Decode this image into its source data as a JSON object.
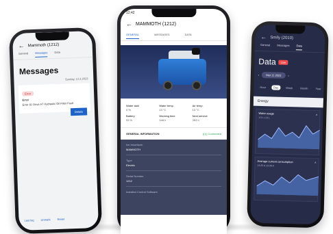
{
  "left_phone": {
    "header_title": "Mammoth (1212)",
    "tabs": [
      "General",
      "Messages",
      "Data"
    ],
    "active_tab": 1,
    "title": "Messages",
    "card": {
      "date": "Sunday, 12.3.2023",
      "tag": "Error",
      "line1": "Error",
      "text": "Error 81 Drive A7 Hydraulic Oil Filter Fault",
      "button": "Details"
    },
    "footer_links": [
      "Last log",
      "Unmark",
      "Reset"
    ]
  },
  "center_phone": {
    "status_time": "12:42",
    "header_title": "MAMMOTH (1212)",
    "tabs": [
      "GENERAL",
      "MESSAGES",
      "DATA"
    ],
    "active_tab": 0,
    "stats": [
      {
        "label": "Water tank",
        "value": "0 %"
      },
      {
        "label": "Water temp.",
        "value": "13 °C"
      },
      {
        "label": "Air temp.",
        "value": "13 °C"
      },
      {
        "label": "Battery",
        "value": "93 %"
      },
      {
        "label": "Working time",
        "value": "148 h"
      },
      {
        "label": "Next service",
        "value": "353 h"
      }
    ],
    "general_info_title": "GENERAL INFORMATION",
    "connection_status": "((•)) Connected",
    "info_rows": [
      {
        "label": "Ice resurfacer",
        "value": "MAMMOTH"
      },
      {
        "label": "Type",
        "value": "Electric"
      },
      {
        "label": "Serial Number",
        "value": "1212"
      },
      {
        "label": "Installed Control Software",
        "value": ""
      }
    ]
  },
  "right_phone": {
    "header_title": "Smily (2010)",
    "tabs": [
      "General",
      "Messages",
      "Data"
    ],
    "active_tab": 2,
    "title": "Data",
    "title_tag": "Live",
    "date_pill": "Mar 11 2023",
    "periods": [
      "Hour",
      "Day",
      "Week",
      "Month",
      "Year"
    ],
    "active_period": 1,
    "energy_label": "Energy",
    "water_usage": {
      "title": "Water usage",
      "nums": "1.5 L    1.0 L"
    },
    "current_consumption": {
      "title": "Average current consumption",
      "nums": "13.25 A    13.39 A"
    }
  },
  "colors": {
    "accent": "#1e63c9",
    "dark": "#262b47",
    "info_bg": "#3d4460",
    "connected": "#2ea44f"
  }
}
